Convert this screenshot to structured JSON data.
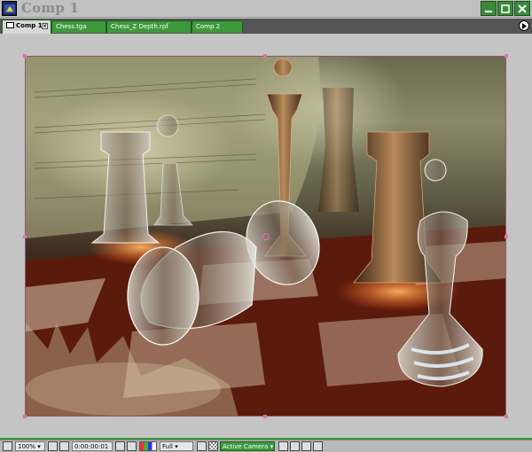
{
  "window": {
    "title": "Comp 1",
    "icons": {
      "app": "after-effects-comp-icon",
      "minimize": "minimize-icon",
      "maximize": "maximize-icon",
      "close": "close-icon"
    }
  },
  "tabs": [
    {
      "label": "Comp 1",
      "active": true
    },
    {
      "label": "Chess.tga",
      "active": false
    },
    {
      "label": "Chess_Z Depth.rpf",
      "active": false
    },
    {
      "label": "Comp 2",
      "active": false
    }
  ],
  "tab_menu_icon": "panel-menu-arrow-icon",
  "viewer": {
    "content": "chess-render-image"
  },
  "bottom_toolbar": {
    "zoom": "100%",
    "timecode": "0:00:00:01",
    "resolution": "Full",
    "camera": "Active Camera",
    "icons": [
      "magnifier-icon",
      "safe-margins-icon",
      "grid-icon",
      "snapshot-icon",
      "channel-rgb-icon",
      "region-of-interest-icon",
      "transparency-grid-icon",
      "view-options-icon",
      "flowchart-icon"
    ]
  },
  "colors": {
    "accent_green": "#3c9a3c",
    "panel_gray": "#c4c4c4",
    "handle_pink": "#e070b0"
  }
}
